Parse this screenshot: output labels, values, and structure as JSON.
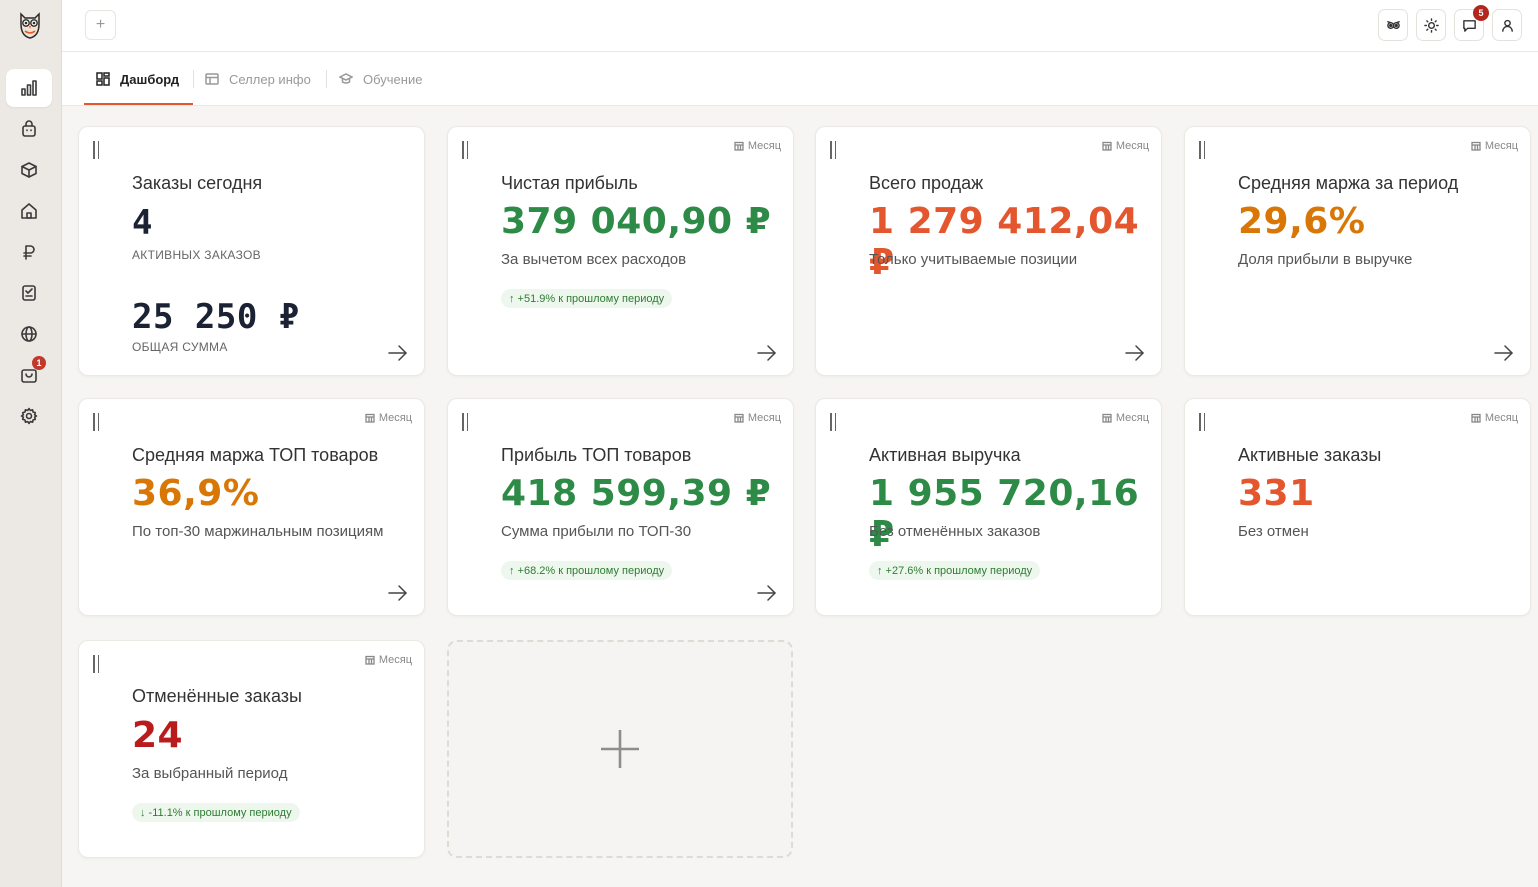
{
  "sidebar": {
    "nav_items": [
      {
        "name": "dashboard",
        "icon": "bar-chart-icon",
        "active": true
      },
      {
        "name": "bag",
        "icon": "shopping-bag-icon"
      },
      {
        "name": "products",
        "icon": "box-icon"
      },
      {
        "name": "warehouse",
        "icon": "home-icon"
      },
      {
        "name": "finance",
        "icon": "ruble-icon"
      },
      {
        "name": "reports",
        "icon": "checklist-icon"
      },
      {
        "name": "web",
        "icon": "globe-icon"
      },
      {
        "name": "store",
        "icon": "store-icon",
        "badge": "1"
      },
      {
        "name": "settings",
        "icon": "gear-icon"
      }
    ]
  },
  "topbar": {
    "add_label": "+",
    "chat_badge": "5"
  },
  "tabs": [
    {
      "label": "Дашборд",
      "active": true
    },
    {
      "label": "Селлер инфо"
    },
    {
      "label": "Обучение"
    }
  ],
  "cards": {
    "orders_today": {
      "title": "Заказы сегодня",
      "count": "4",
      "count_label": "АКТИВНЫХ ЗАКАЗОВ",
      "sum": "25 250 ₽",
      "sum_label": "ОБЩАЯ СУММА"
    },
    "net_profit": {
      "period": "Месяц",
      "title": "Чистая прибыль",
      "value": "379 040,90 ₽",
      "sub": "За вычетом всех расходов",
      "delta": "↑ +51.9% к прошлому периоду"
    },
    "total_sales": {
      "period": "Месяц",
      "title": "Всего продаж",
      "value": "1 279 412,04 ₽",
      "sub": "Только учитываемые позиции"
    },
    "avg_margin": {
      "period": "Месяц",
      "title": "Средняя маржа за период",
      "value": "29,6%",
      "sub": "Доля прибыли в выручке"
    },
    "top_margin": {
      "period": "Месяц",
      "title": "Средняя маржа ТОП товаров",
      "value": "36,9%",
      "sub": "По топ-30 маржинальным позициям"
    },
    "top_profit": {
      "period": "Месяц",
      "title": "Прибыль ТОП товаров",
      "value": "418 599,39 ₽",
      "sub": "Сумма прибыли по ТОП-30",
      "delta": "↑ +68.2% к прошлому периоду"
    },
    "active_revenue": {
      "period": "Месяц",
      "title": "Активная выручка",
      "value": "1 955 720,16 ₽",
      "sub": "Без отменённых заказов",
      "delta": "↑ +27.6% к прошлому периоду"
    },
    "active_orders": {
      "period": "Месяц",
      "title": "Активные заказы",
      "value": "331",
      "sub": "Без отмен"
    },
    "cancelled_orders": {
      "period": "Месяц",
      "title": "Отменённые заказы",
      "value": "24",
      "sub": "За выбранный период",
      "delta": "↓ -11.1% к прошлому периоду"
    }
  },
  "colors": {
    "accent": "#e4572e",
    "green": "#2e8b47",
    "amber": "#d97706",
    "red": "#b91c1c"
  }
}
